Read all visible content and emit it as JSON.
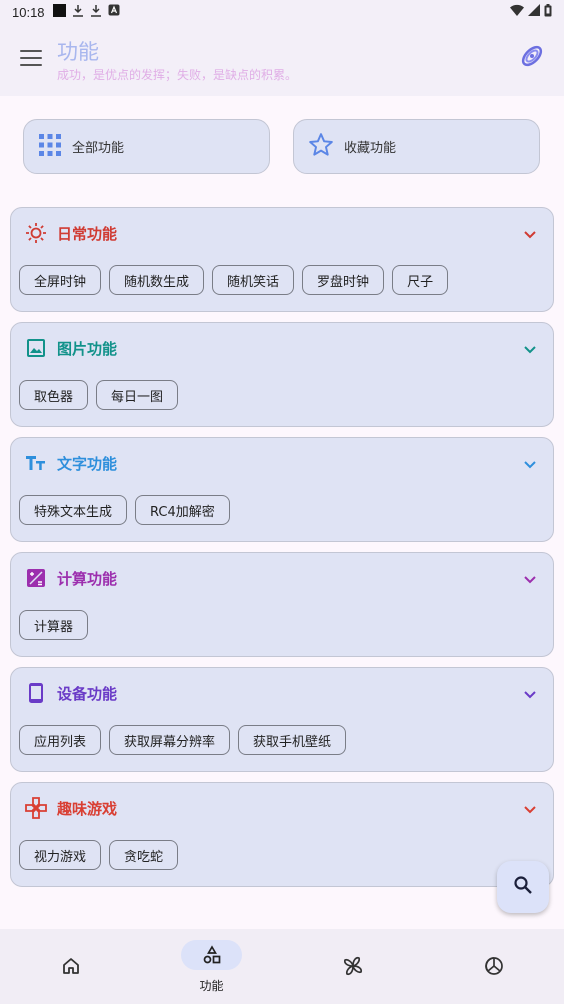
{
  "status_bar": {
    "time": "10:18"
  },
  "app_bar": {
    "title": "功能",
    "subtitle": "成功，是优点的发挥；失败，是缺点的积累。"
  },
  "top_buttons": [
    {
      "label": "全部功能",
      "icon": "grid-icon"
    },
    {
      "label": "收藏功能",
      "icon": "star-icon"
    }
  ],
  "sections": [
    {
      "title": "日常功能",
      "icon": "sun-icon",
      "color": "#d03b33",
      "chips": [
        "全屏时钟",
        "随机数生成",
        "随机笑话",
        "罗盘时钟",
        "尺子"
      ]
    },
    {
      "title": "图片功能",
      "icon": "image-icon",
      "color": "#12928a",
      "chips": [
        "取色器",
        "每日一图"
      ]
    },
    {
      "title": "文字功能",
      "icon": "text-icon",
      "color": "#2e8fdc",
      "chips": [
        "特殊文本生成",
        "RC4加解密"
      ]
    },
    {
      "title": "计算功能",
      "icon": "calculate-icon",
      "color": "#9c2fae",
      "chips": [
        "计算器"
      ]
    },
    {
      "title": "设备功能",
      "icon": "phone-icon",
      "color": "#6a3bc7",
      "chips": [
        "应用列表",
        "获取屏幕分辨率",
        "获取手机壁纸"
      ]
    },
    {
      "title": "趣味游戏",
      "icon": "gamepad-icon",
      "color": "#d93f33",
      "chips": [
        "视力游戏",
        "贪吃蛇"
      ]
    }
  ],
  "bottom_nav": [
    {
      "label": "",
      "icon": "home-icon"
    },
    {
      "label": "功能",
      "icon": "category-icon",
      "active": true
    },
    {
      "label": "",
      "icon": "pinwheel-icon"
    },
    {
      "label": "",
      "icon": "palette-icon"
    }
  ],
  "colors": {
    "accent": "#dce2f9",
    "card": "#dfe3f4"
  }
}
